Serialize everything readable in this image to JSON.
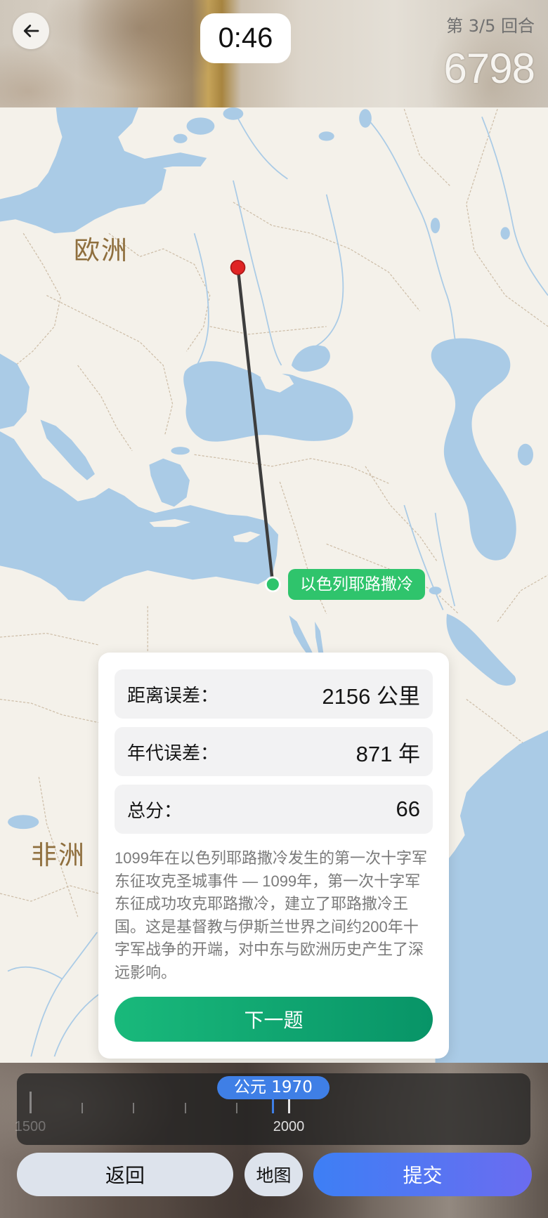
{
  "header": {
    "back_icon": "arrow-left-icon",
    "timer": "0:46",
    "round": "第 3/5 回合",
    "score": "6798"
  },
  "map": {
    "region_labels": [
      "欧洲",
      "非洲"
    ],
    "guess_pin_icon": "red-pin-icon",
    "answer_pin_icon": "green-pin-icon",
    "answer_label": "以色列耶路撒冷",
    "colors": {
      "land": "#f4f1ea",
      "water": "#aacbe6",
      "guess": "#e02424",
      "answer": "#2fc46c",
      "distance_line": "#3d3d3d"
    }
  },
  "result": {
    "rows": [
      {
        "label": "距离误差：",
        "value": "2156 公里"
      },
      {
        "label": "年代误差：",
        "value": "871 年"
      },
      {
        "label": "总分：",
        "value": "66"
      }
    ],
    "description": "1099年在以色列耶路撒冷发生的第一次十字军东征攻克圣城事件 — 1099年，第一次十字军东征成功攻克耶路撒冷，建立了耶路撒冷王国。这是基督教与伊斯兰世界之间约200年十字军战争的开端，对中东与欧洲历史产生了深远影响。",
    "next_button": "下一题"
  },
  "timeline": {
    "selected_label": "公元 1970",
    "selected_year": 1970,
    "tick_labels": [
      "1500",
      "2000"
    ]
  },
  "actions": {
    "back": "返回",
    "map": "地图",
    "submit": "提交"
  }
}
